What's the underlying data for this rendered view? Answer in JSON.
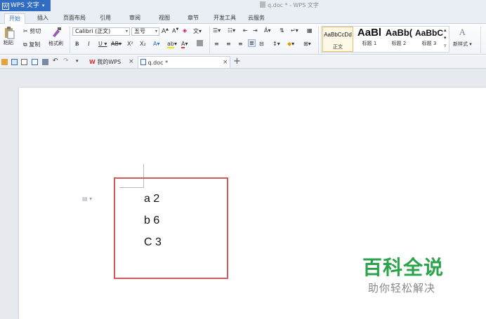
{
  "app": {
    "name": "WPS 文字",
    "window_title": "q.doc * - WPS 文字"
  },
  "menu_tabs": [
    "开始",
    "插入",
    "页面布局",
    "引用",
    "审阅",
    "视图",
    "章节",
    "开发工具",
    "云服务"
  ],
  "ribbon": {
    "paste": "粘贴",
    "cut": "剪切",
    "copy": "复制",
    "format_painter": "格式刷",
    "font_name": "Calibri (正文)",
    "font_size": "五号",
    "styles": [
      {
        "sample": "AaBbCcDd",
        "name": "正文"
      },
      {
        "sample": "AaBl",
        "name": "标题 1"
      },
      {
        "sample": "AaBb(",
        "name": "标题 2"
      },
      {
        "sample": "AaBbC",
        "name": "标题 3"
      }
    ],
    "new_style": "新样式"
  },
  "doc_tabs": [
    {
      "label": "我的WPS"
    },
    {
      "label": "q.doc *"
    }
  ],
  "document": {
    "lines": [
      "a 2",
      "b 6",
      "C 3"
    ]
  },
  "watermark": {
    "title": "百科全说",
    "subtitle": "助你轻松解决"
  },
  "colors": {
    "accent": "#2f6cc2",
    "highlight_box": "#d45a5a",
    "watermark": "#2aa34a"
  }
}
